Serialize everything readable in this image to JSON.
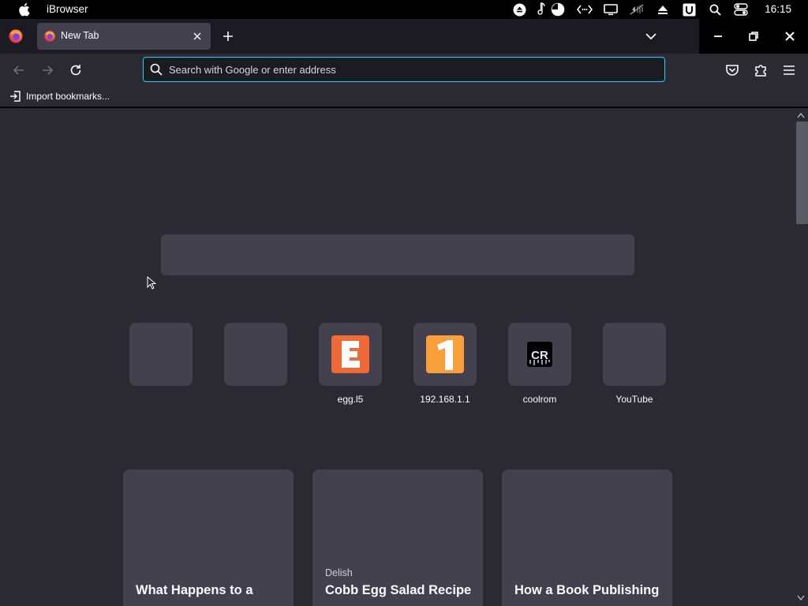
{
  "menubar": {
    "app_name": "iBrowser",
    "clock": "16:15",
    "tray_icons": [
      "eject-circle-icon",
      "music-note-icon",
      "pie-chart-icon",
      "code-icon",
      "display-icon",
      "mute-icon",
      "eject-icon",
      "u-badge-icon",
      "search-icon",
      "control-center-icon"
    ]
  },
  "tabs": [
    {
      "title": "New Tab",
      "active": true
    }
  ],
  "toolbar": {
    "url_placeholder": "Search with Google or enter address",
    "url_value": ""
  },
  "bookmarks": {
    "import_label": "Import bookmarks..."
  },
  "top_sites": [
    {
      "label": "",
      "icon": ""
    },
    {
      "label": "",
      "icon": ""
    },
    {
      "label": "egg.l5",
      "icon": "letter-e-icon",
      "icon_text": "E",
      "color": "#f06a38"
    },
    {
      "label": "192.168.1.1",
      "icon": "number-one-icon",
      "icon_text": "1",
      "color": "#f7a03b"
    },
    {
      "label": "coolrom",
      "icon": "coolrom-logo-icon",
      "icon_text": "CR",
      "color": "#000000"
    },
    {
      "label": "YouTube",
      "icon": ""
    }
  ],
  "stories": [
    {
      "source": "",
      "title": "What Happens to a"
    },
    {
      "source": "Delish",
      "title": "Cobb Egg Salad Recipe"
    },
    {
      "source": "",
      "title": "How a Book Publishing"
    }
  ],
  "colors": {
    "accent": "#00ddff",
    "frame": "#1c1b22",
    "toolbar": "#2b2a33",
    "tile": "#42414d"
  }
}
